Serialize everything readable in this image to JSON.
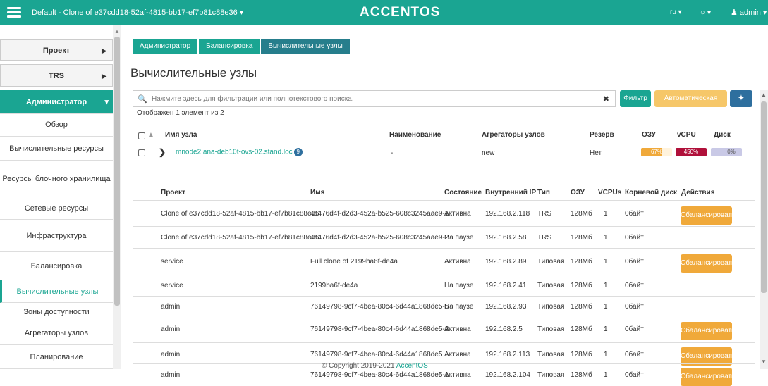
{
  "topbar": {
    "project": "Default - Clone of e37cdd18-52af-4815-bb17-ef7b81c88e36 ▾",
    "brand": "ACCENTOS",
    "lang": "ru ▾",
    "theme": "○ ▾",
    "user": "♟ admin ▾"
  },
  "sidebar": {
    "project": "Проект",
    "trs": "TRS",
    "admin": "Администратор",
    "items": [
      "Обзор",
      "Вычислительные ресурсы",
      "Ресурсы блочного хранилища",
      "Сетевые ресурсы",
      "Инфраструктура",
      "Балансировка",
      "Вычислительные узлы",
      "Зоны доступности",
      "Агрегаторы узлов",
      "Планирование"
    ]
  },
  "breadcrumb": [
    "Администратор",
    "Балансировка",
    "Вычислительные узлы"
  ],
  "page_title": "Вычислительные узлы",
  "filter": {
    "placeholder": "Нажмите здесь для фильтрации или полнотекстового поиска.",
    "filter_btn": "Фильтр",
    "auto_btn": "Автоматическая Балансировка",
    "info_btn": "✦"
  },
  "count_text": "Отображен 1 элемент из 2",
  "table_headers": {
    "name": "Имя узла",
    "title": "Наименование",
    "aggregators": "Агрегаторы узлов",
    "reserve": "Резерв",
    "ram": "ОЗУ",
    "vcpu": "vCPU",
    "disk": "Диск"
  },
  "host": {
    "name": "mnode2.ana-deb10t-ovs-02.stand.loc",
    "badge": "9",
    "title": "-",
    "aggregators": "new",
    "reserve": "Нет",
    "ram_label": "67%",
    "ram_value": 0.67,
    "vcpu_label": "450%",
    "vcpu_value": 1.0,
    "disk_label": "0%",
    "disk_value": 0
  },
  "sub_headers": {
    "project": "Проект",
    "name": "Имя",
    "state": "Состояние",
    "ip": "Внутренний IP",
    "type": "Тип",
    "ram": "ОЗУ",
    "vcpus": "VCPUs",
    "disk": "Корневой диск",
    "actions": "Действия"
  },
  "instances": [
    {
      "project": "Clone of e37cdd18-52af-4815-bb17-ef7b81c88e36",
      "name": "4c476d4f-d2d3-452a-b525-608c3245aae9-1",
      "state": "Активна",
      "ip": "192.168.2.118",
      "type": "TRS",
      "ram": "128Мб",
      "vcpus": "1",
      "disk": "0байт",
      "action": "Сбалансировать"
    },
    {
      "project": "Clone of e37cdd18-52af-4815-bb17-ef7b81c88e36",
      "name": "4c476d4f-d2d3-452a-b525-608c3245aae9-2",
      "state": "На паузе",
      "ip": "192.168.2.58",
      "type": "TRS",
      "ram": "128Мб",
      "vcpus": "1",
      "disk": "0байт",
      "action": ""
    },
    {
      "project": "service",
      "name": "Full clone of 2199ba6f-de4a",
      "state": "Активна",
      "ip": "192.168.2.89",
      "type": "Типовая",
      "ram": "128Мб",
      "vcpus": "1",
      "disk": "0байт",
      "action": "Сбалансировать"
    },
    {
      "project": "service",
      "name": "2199ba6f-de4a",
      "state": "На паузе",
      "ip": "192.168.2.41",
      "type": "Типовая",
      "ram": "128Мб",
      "vcpus": "1",
      "disk": "0байт",
      "action": ""
    },
    {
      "project": "admin",
      "name": "76149798-9cf7-4bea-80c4-6d44a1868de5-5",
      "state": "На паузе",
      "ip": "192.168.2.93",
      "type": "Типовая",
      "ram": "128Мб",
      "vcpus": "1",
      "disk": "0байт",
      "action": ""
    },
    {
      "project": "admin",
      "name": "76149798-9cf7-4bea-80c4-6d44a1868de5-2",
      "state": "Активна",
      "ip": "192.168.2.5",
      "type": "Типовая",
      "ram": "128Мб",
      "vcpus": "1",
      "disk": "0байт",
      "action": "Сбалансировать"
    },
    {
      "project": "admin",
      "name": "76149798-9cf7-4bea-80c4-6d44a1868de5",
      "state": "Активна",
      "ip": "192.168.2.113",
      "type": "Типовая",
      "ram": "128Мб",
      "vcpus": "1",
      "disk": "0байт",
      "action": "Сбалансировать"
    },
    {
      "project": "admin",
      "name": "76149798-9cf7-4bea-80c4-6d44a1868de5-1",
      "state": "Активна",
      "ip": "192.168.2.104",
      "type": "Типовая",
      "ram": "128Мб",
      "vcpus": "1",
      "disk": "0байт",
      "action": "Сбалансировать"
    }
  ],
  "footer": {
    "text": "© Copyright 2019-2021 ",
    "link": "AccentOS"
  },
  "colors": {
    "accent": "#1aa592",
    "ram_bar": "#f0a93a",
    "vcpu_bar": "#b0103a",
    "disk_bar": "#c9c9e6",
    "action": "#f0a93a"
  }
}
